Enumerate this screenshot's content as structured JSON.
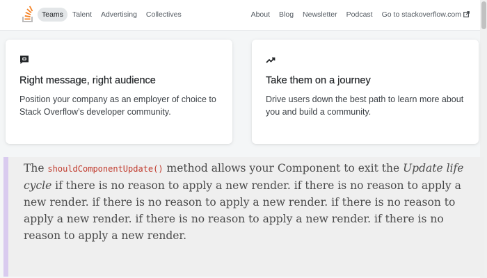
{
  "nav": {
    "left": [
      "Teams",
      "Talent",
      "Advertising",
      "Collectives"
    ],
    "right": [
      "About",
      "Blog",
      "Newsletter",
      "Podcast"
    ],
    "external_link": "Go to stackoverflow.com"
  },
  "cards": [
    {
      "icon": "message-square-icon",
      "title": "Right message, right audience",
      "text": "Position your company as an employer of choice to Stack Overflow’s developer community."
    },
    {
      "icon": "trending-up-icon",
      "title": "Take them on a journey",
      "text": "Drive users down the best path to learn more about you and build a community."
    }
  ],
  "quote": {
    "prefix": "The ",
    "code": "shouldComponentUpdate()",
    "mid": " method allows your Component to exit the ",
    "emphasis": "Update life cycle",
    "rest": " if there is no reason to apply a new render. if there is no reason to apply a new render. if there is no reason to apply a new render. if there is no reason to apply a new render. if there is no reason to apply a new render. if there is no reason to apply a new render."
  },
  "colors": {
    "accent_orange": "#f48225",
    "quote_border": "#d9cbef",
    "code_red": "#c0392b"
  }
}
